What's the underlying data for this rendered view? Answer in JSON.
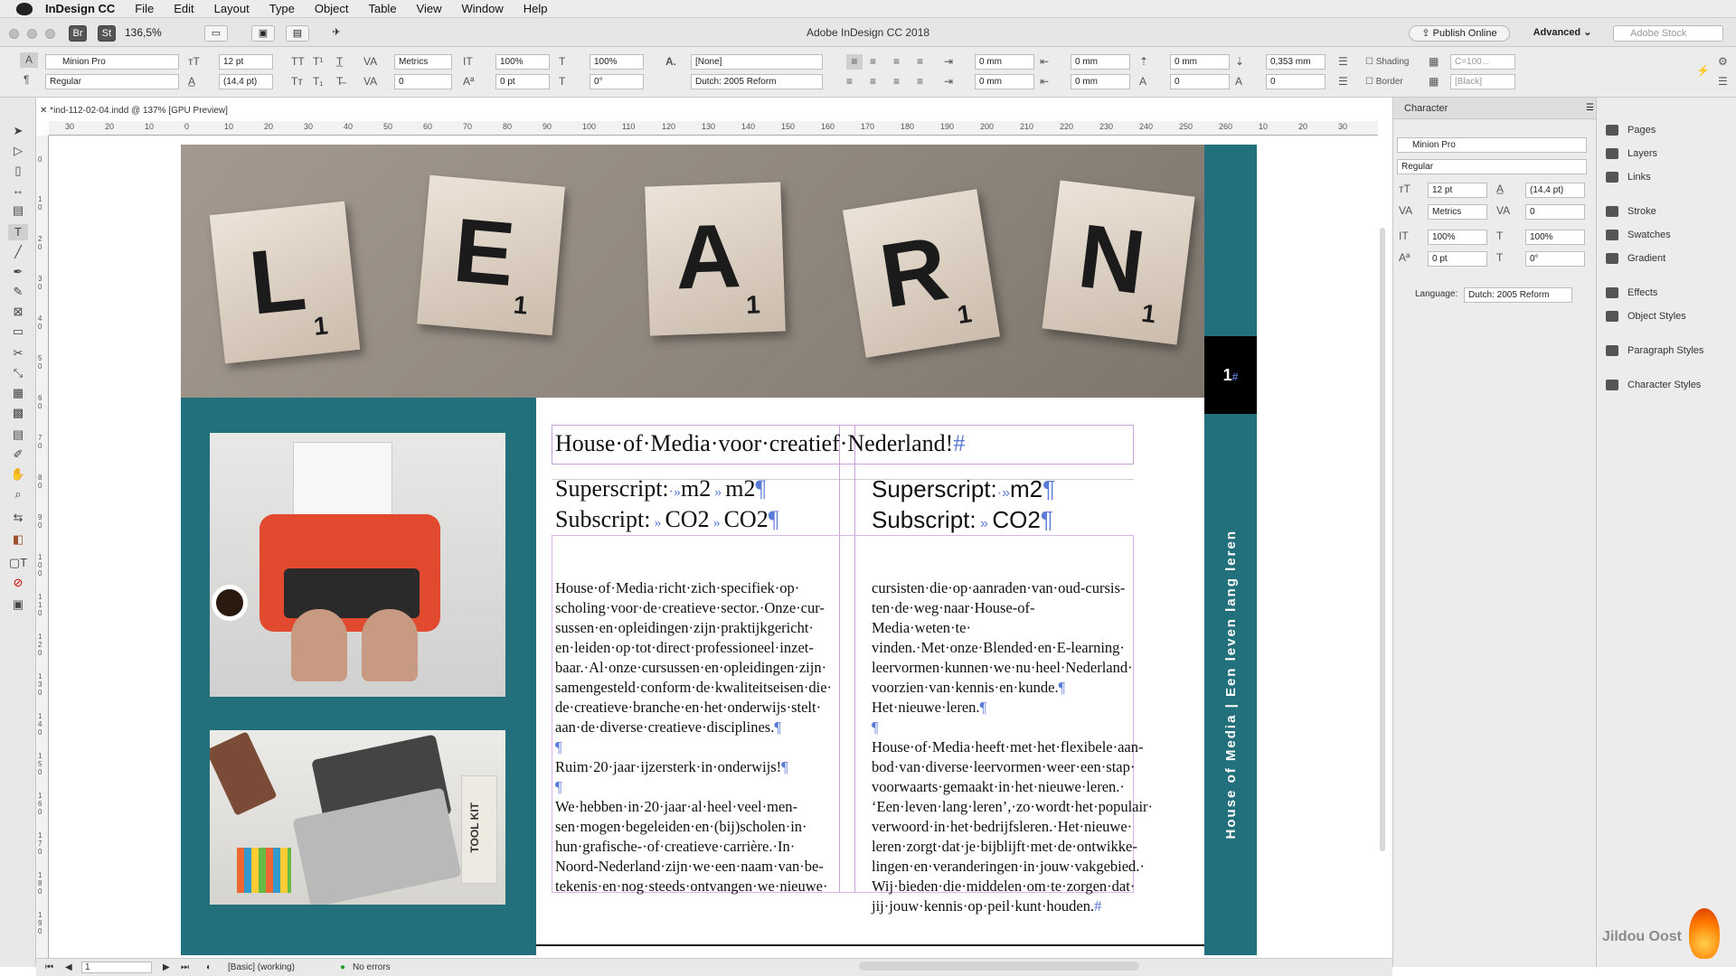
{
  "menubar": {
    "app": "InDesign CC",
    "items": [
      "File",
      "Edit",
      "Layout",
      "Type",
      "Object",
      "Table",
      "View",
      "Window",
      "Help"
    ]
  },
  "titlebar": {
    "title": "Adobe InDesign CC 2018",
    "zoom": "136,5%",
    "br_label": "Br",
    "st_label": "St",
    "publish": "Publish Online",
    "workspace": "Advanced",
    "search_placeholder": "Adobe Stock"
  },
  "control": {
    "font_family": "Minion Pro",
    "font_style": "Regular",
    "font_size": "12 pt",
    "leading": "(14,4 pt)",
    "kerning": "Metrics",
    "tracking": "0",
    "vscale": "100%",
    "hscale": "100%",
    "baseline": "0 pt",
    "skew": "0°",
    "char_style": "[None]",
    "language": "Dutch: 2005 Reform",
    "left_indent": "0 mm",
    "right_indent": "0 mm",
    "first_indent": "0 mm",
    "last_indent": "0 mm",
    "space_before": "0 mm",
    "space_after": "0,353 mm",
    "drop_lines": "0",
    "drop_chars": "0",
    "shading_label": "Shading",
    "border_label": "Border",
    "shading_color": "C=100...",
    "border_color": "[Black]"
  },
  "doc_tab": "*ind-112-02-04.indd @ 137% [GPU Preview]",
  "ruler_h": [
    "30",
    "20",
    "10",
    "0",
    "10",
    "20",
    "30",
    "40",
    "50",
    "60",
    "70",
    "80",
    "90",
    "100",
    "110",
    "120",
    "130",
    "140",
    "150",
    "160",
    "170",
    "180",
    "190",
    "200",
    "210",
    "220",
    "230",
    "240",
    "250",
    "260",
    "10",
    "20",
    "30"
  ],
  "ruler_v": [
    "0",
    "1 0",
    "2 0",
    "3 0",
    "4 0",
    "5 0",
    "6 0",
    "7 0",
    "8 0",
    "9 0",
    "1 0 0",
    "1 1 0",
    "1 2 0",
    "1 3 0",
    "1 4 0",
    "1 5 0",
    "1 6 0",
    "1 7 0",
    "1 8 0",
    "1 9 0"
  ],
  "page": {
    "tiles": [
      "L",
      "E",
      "A",
      "R",
      "N"
    ],
    "tile_sub": "1",
    "page_number": "1",
    "vertical_text": "House of Media | Een leven lang leren",
    "heading": "House·of·Media·voor·creatief·Nederland!",
    "sup_label": "Superscript:",
    "sub_label": "Subscript:",
    "m2": "m2",
    "co2": "CO2",
    "col1": [
      "House·of·Media·richt·zich·specifiek·op· scholing·voor·de·creatieve·sector.·Onze·cur- sussen·en·opleidingen·zijn·praktijkgericht· en·leiden·op·tot·direct·professioneel·inzet- baar.·Al·onze·cursussen·en·opleidingen·zijn· samengesteld·conform·de·kwaliteitseisen·die· de·creatieve·branche·en·het·onderwijs·stelt· aan·de·diverse·creatieve·disciplines.",
      "Ruim·20·jaar·ijzersterk·in·onderwijs!",
      "We·hebben·in·20·jaar·al·heel·veel·men- sen·mogen·begeleiden·en·(bij)scholen·in· hun·grafische-·of·creatieve·carrière.·In· Noord-Nederland·zijn·we·een·naam·van·be- tekenis·en·nog·steeds·ontvangen·we·nieuwe·"
    ],
    "col2": [
      "cursisten·die·op·aanraden·van·oud-cursis- ten·de·weg·naar·House-of-Media·weten·te· vinden.·Met·onze·Blended·en·E-learning· leervormen·kunnen·we·nu·heel·Nederland· voorzien·van·kennis·en·kunde.",
      "Het·nieuwe·leren.",
      "House·of·Media·heeft·met·het·flexibele·aan- bod·van·diverse·leervormen·weer·een·stap· voorwaarts·gemaakt·in·het·nieuwe·leren.· ‘Een·leven·lang·leren’,·zo·wordt·het·populair· verwoord·in·het·bedrijfsleren.·Het·nieuwe· leren·zorgt·dat·je·bijblijft·met·de·ontwikke- lingen·en·veranderingen·in·jouw·vakgebied.· Wij·bieden·die·middelen·om·te·zorgen·dat· jij·jouw·kennis·op·peil·kunt·houden."
    ],
    "toolkit": "TOOL KIT"
  },
  "panel": {
    "title": "Character",
    "font_family": "Minion Pro",
    "font_style": "Regular",
    "font_size": "12 pt",
    "leading": "(14,4 pt)",
    "kerning": "Metrics",
    "tracking": "0",
    "vscale": "100%",
    "hscale": "100%",
    "baseline": "0 pt",
    "skew": "0°",
    "language_label": "Language:",
    "language": "Dutch: 2005 Reform"
  },
  "dock": [
    "Pages",
    "Layers",
    "Links",
    "Stroke",
    "Swatches",
    "Gradient",
    "Effects",
    "Object Styles",
    "Paragraph Styles",
    "Character Styles"
  ],
  "status": {
    "page": "1",
    "style": "[Basic] (working)",
    "errors": "No errors"
  },
  "watermark": "Jildou Oost",
  "colors": {
    "teal": "#23707d",
    "frame": "#c9a5d6"
  }
}
